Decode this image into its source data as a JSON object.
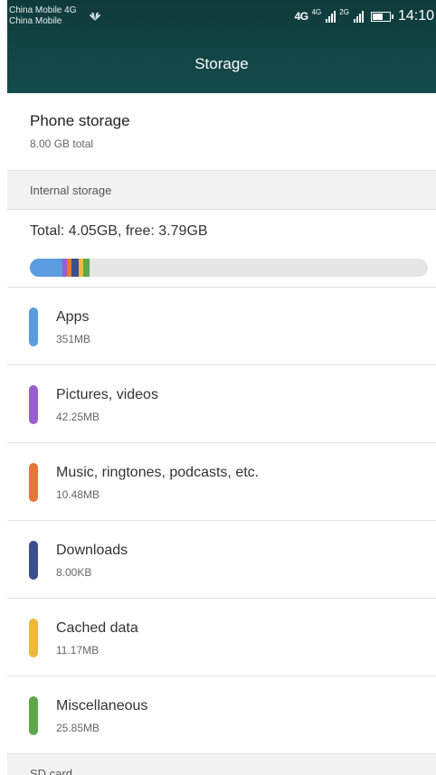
{
  "status_bar": {
    "carrier_line1": "China Mobile 4G",
    "carrier_line2": "China Mobile",
    "network1": "4G",
    "tag1": "4G",
    "tag2": "2G",
    "time": "14:10"
  },
  "header": {
    "title": "Storage"
  },
  "phone_storage": {
    "title": "Phone storage",
    "subtitle": "8.00 GB total"
  },
  "internal_storage": {
    "section_label": "Internal storage",
    "total_text": "Total: 4.05GB, free: 3.79GB",
    "bar_fractions": [
      0.081,
      0.012,
      0.012,
      0.018,
      0.012,
      0.015
    ],
    "categories": [
      {
        "name": "Apps",
        "size": "351MB",
        "color": "#5b9be0"
      },
      {
        "name": "Pictures, videos",
        "size": "42.25MB",
        "color": "#9a5ed3"
      },
      {
        "name": "Music, ringtones, podcasts, etc.",
        "size": "10.48MB",
        "color": "#e8763a"
      },
      {
        "name": "Downloads",
        "size": "8.00KB",
        "color": "#3a4f8c"
      },
      {
        "name": "Cached data",
        "size": "11.17MB",
        "color": "#f0b83a"
      },
      {
        "name": "Miscellaneous",
        "size": "25.85MB",
        "color": "#5ca84a"
      }
    ]
  },
  "sd_card": {
    "section_label": "SD card"
  }
}
